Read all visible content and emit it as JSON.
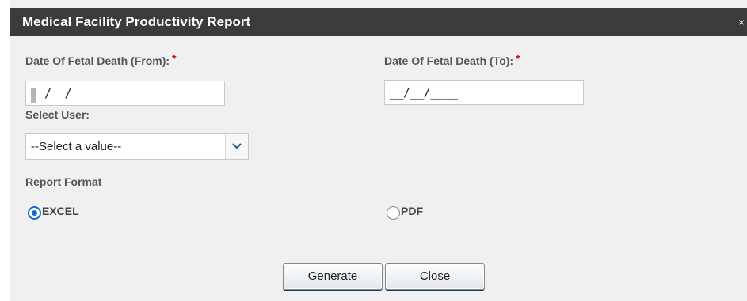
{
  "dialog": {
    "title": "Medical Facility Productivity Report",
    "close_symbol": "×"
  },
  "fields": {
    "date_from": {
      "label": "Date Of Fetal Death (From):",
      "required_mark": "*",
      "mask": "__/__/____"
    },
    "date_to": {
      "label": "Date Of Fetal Death (To):",
      "required_mark": "*",
      "mask": "__/__/____"
    },
    "select_user": {
      "label": "Select User:",
      "selected_value": "--Select a value--",
      "icon": "chevron-down-icon"
    }
  },
  "report_format": {
    "label": "Report Format",
    "options": [
      {
        "label": "EXCEL",
        "checked": true
      },
      {
        "label": "PDF",
        "checked": false
      }
    ]
  },
  "buttons": {
    "generate_label": "Generate",
    "close_label": "Close"
  },
  "colors": {
    "titlebar": "#3b3b3b",
    "radio_accent": "#1566d8",
    "required": "#cc0000"
  }
}
